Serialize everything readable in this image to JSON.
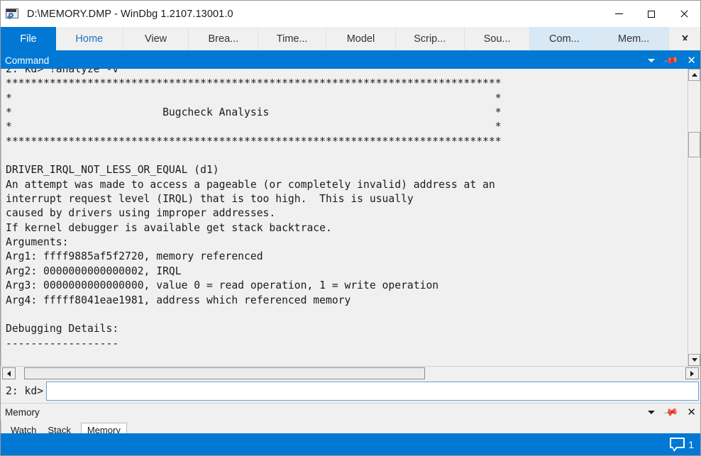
{
  "window": {
    "title": "D:\\MEMORY.DMP - WinDbg 1.2107.13001.0",
    "icon": "windbg-icon",
    "controls": {
      "minimize": "minimize-icon",
      "maximize": "maximize-icon",
      "close": "close-icon"
    }
  },
  "ribbon": {
    "tabs": [
      {
        "label": "File",
        "state": "file"
      },
      {
        "label": "Home",
        "state": "home"
      },
      {
        "label": "View",
        "state": "normal"
      },
      {
        "label": "Brea...",
        "state": "normal"
      },
      {
        "label": "Time...",
        "state": "normal"
      },
      {
        "label": "Model",
        "state": "normal"
      },
      {
        "label": "Scrip...",
        "state": "normal"
      },
      {
        "label": "Sou...",
        "state": "normal"
      },
      {
        "label": "Com...",
        "state": "selected"
      },
      {
        "label": "Mem...",
        "state": "selected"
      }
    ],
    "overflow_icon": "chevron-down-icon"
  },
  "command_panel": {
    "title": "Command",
    "tools": {
      "dropdown": "caret-down-icon",
      "pin": "pin-icon",
      "close": "close-icon"
    },
    "output": "2: kd> !analyze -v\n*******************************************************************************\n*                                                                             *\n*                        Bugcheck Analysis                                    *\n*                                                                             *\n*******************************************************************************\n\nDRIVER_IRQL_NOT_LESS_OR_EQUAL (d1)\nAn attempt was made to access a pageable (or completely invalid) address at an\ninterrupt request level (IRQL) that is too high.  This is usually\ncaused by drivers using improper addresses.\nIf kernel debugger is available get stack backtrace.\nArguments:\nArg1: ffff9885af5f2720, memory referenced\nArg2: 0000000000000002, IRQL\nArg3: 0000000000000000, value 0 = read operation, 1 = write operation\nArg4: fffff8041eae1981, address which referenced memory\n\nDebugging Details:\n------------------",
    "prompt_label": "2: kd>",
    "prompt_value": "",
    "prompt_placeholder": ""
  },
  "memory_panel": {
    "title": "Memory",
    "tools": {
      "dropdown": "caret-down-icon",
      "pin": "pin-icon",
      "close": "close-icon"
    },
    "tabs": [
      {
        "label": "Watch",
        "active": false
      },
      {
        "label": "Stack",
        "active": false
      },
      {
        "label": "Memory",
        "active": true
      }
    ]
  },
  "statusbar": {
    "notification_icon": "speech-bubble-icon",
    "notification_count": "1"
  },
  "colors": {
    "accent": "#0078d4",
    "tab_selected": "#d8e8f5",
    "home_text": "#1673c0",
    "panel_bg": "#f0f0f0"
  }
}
